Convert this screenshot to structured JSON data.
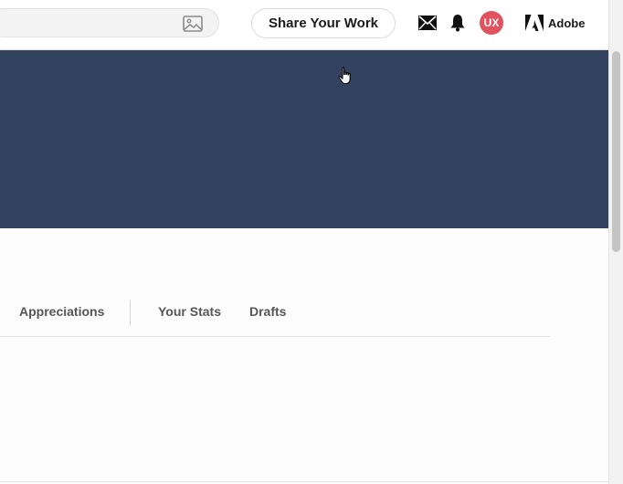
{
  "header": {
    "search": {
      "value": "",
      "placeholder": ""
    },
    "image_search_icon": "image-search-icon",
    "share_label": "Share Your Work",
    "messages_icon": "mail-icon",
    "notifications_icon": "bell-icon",
    "avatar_initials": "UX",
    "avatar_color": "#e0525e",
    "adobe_label": "Adobe"
  },
  "banner": {
    "color": "#33435f"
  },
  "tabs": [
    {
      "label": "Appreciations"
    },
    {
      "label": "Your Stats"
    },
    {
      "label": "Drafts"
    }
  ]
}
